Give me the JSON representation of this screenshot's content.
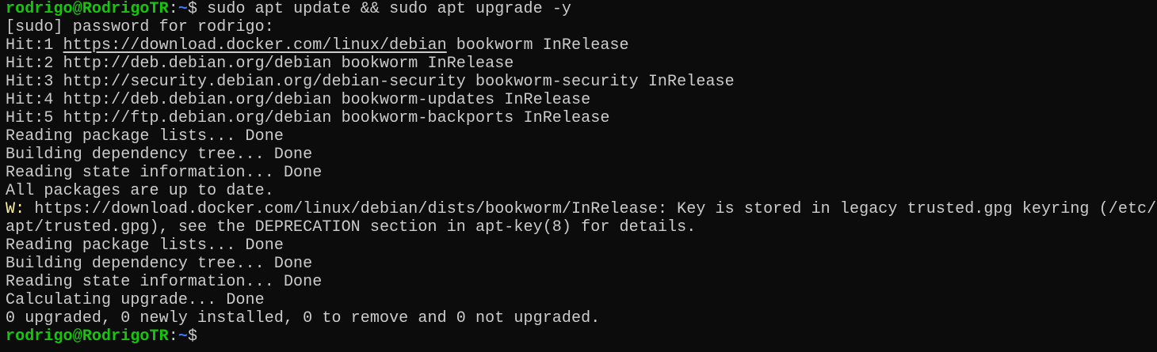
{
  "colors": {
    "background": "#0c0c0c",
    "foreground": "#cccccc",
    "prompt_user": "#16c60c",
    "prompt_path": "#3b78ff",
    "warning": "#f9f1a5"
  },
  "terminal": {
    "lines": [
      [
        {
          "t": "rodrigo@RodrigoTR",
          "c": "green"
        },
        {
          "t": ":",
          "c": ""
        },
        {
          "t": "~",
          "c": "blue"
        },
        {
          "t": "$ sudo apt update && sudo apt upgrade -y",
          "c": ""
        }
      ],
      [
        {
          "t": "[sudo] password for rodrigo:",
          "c": ""
        }
      ],
      [
        {
          "t": "Hit:1 ",
          "c": ""
        },
        {
          "t": "https://download.docker.com/linux/debian",
          "c": "link"
        },
        {
          "t": " bookworm InRelease",
          "c": ""
        }
      ],
      [
        {
          "t": "Hit:2 http://deb.debian.org/debian bookworm InRelease",
          "c": ""
        }
      ],
      [
        {
          "t": "Hit:3 http://security.debian.org/debian-security bookworm-security InRelease",
          "c": ""
        }
      ],
      [
        {
          "t": "Hit:4 http://deb.debian.org/debian bookworm-updates InRelease",
          "c": ""
        }
      ],
      [
        {
          "t": "Hit:5 http://ftp.debian.org/debian bookworm-backports InRelease",
          "c": ""
        }
      ],
      [
        {
          "t": "Reading package lists... Done",
          "c": ""
        }
      ],
      [
        {
          "t": "Building dependency tree... Done",
          "c": ""
        }
      ],
      [
        {
          "t": "Reading state information... Done",
          "c": ""
        }
      ],
      [
        {
          "t": "All packages are up to date.",
          "c": ""
        }
      ],
      [
        {
          "t": "W:",
          "c": "yellow"
        },
        {
          "t": " https://download.docker.com/linux/debian/dists/bookworm/InRelease: Key is stored in legacy trusted.gpg keyring (/etc/",
          "c": ""
        }
      ],
      [
        {
          "t": "apt/trusted.gpg), see the DEPRECATION section in apt-key(8) for details.",
          "c": ""
        }
      ],
      [
        {
          "t": "Reading package lists... Done",
          "c": ""
        }
      ],
      [
        {
          "t": "Building dependency tree... Done",
          "c": ""
        }
      ],
      [
        {
          "t": "Reading state information... Done",
          "c": ""
        }
      ],
      [
        {
          "t": "Calculating upgrade... Done",
          "c": ""
        }
      ],
      [
        {
          "t": "0 upgraded, 0 newly installed, 0 to remove and 0 not upgraded.",
          "c": ""
        }
      ],
      [
        {
          "t": "rodrigo@RodrigoTR",
          "c": "green"
        },
        {
          "t": ":",
          "c": ""
        },
        {
          "t": "~",
          "c": "blue"
        },
        {
          "t": "$ ",
          "c": ""
        }
      ]
    ]
  }
}
